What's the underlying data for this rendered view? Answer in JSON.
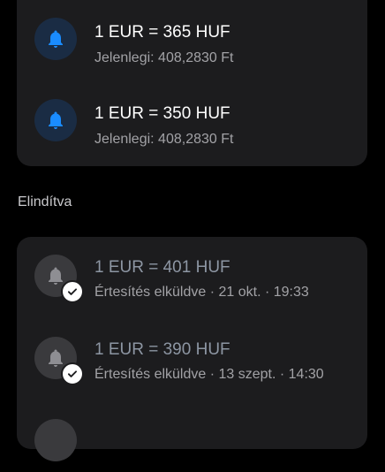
{
  "active_alerts": [
    {
      "title": "1 EUR = 365 HUF",
      "subtitle": "Jelenlegi: 408,2830 Ft"
    },
    {
      "title": "1 EUR = 350 HUF",
      "subtitle": "Jelenlegi: 408,2830 Ft"
    }
  ],
  "triggered_section": {
    "label": "Elindítva",
    "items": [
      {
        "title": "1 EUR = 401 HUF",
        "subtitle": "Értesítés elküldve · 21 okt. · 19:33"
      },
      {
        "title": "1 EUR = 390 HUF",
        "subtitle": "Értesítés elküldve · 13 szept. · 14:30"
      }
    ]
  },
  "colors": {
    "active_bell": "#1a8cff",
    "inactive_bell": "#8e8e93",
    "card_background": "#1c1c1e"
  },
  "icons": {
    "active": "bell-icon",
    "triggered": "bell-icon",
    "badge": "checkmark-icon"
  }
}
